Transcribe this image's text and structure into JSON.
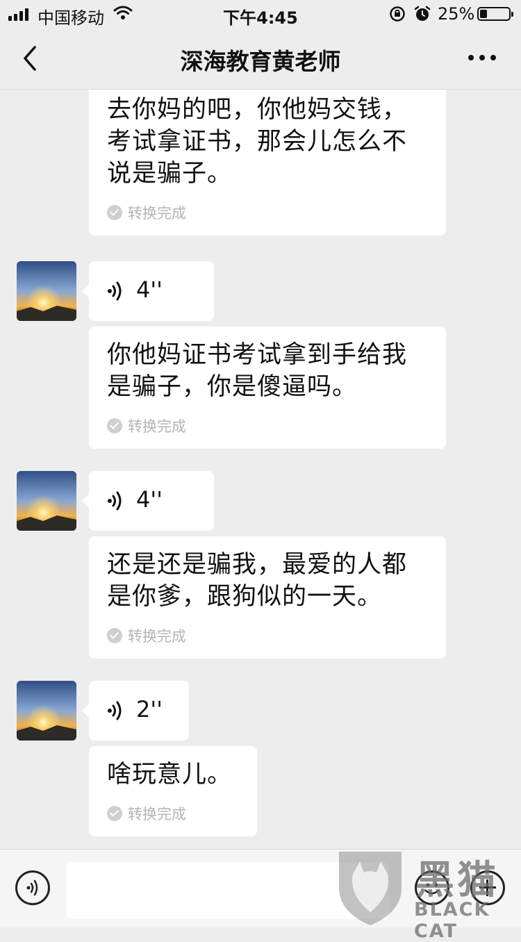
{
  "status_bar": {
    "carrier": "中国移动",
    "time": "下午4:45",
    "battery_percent": "25%",
    "battery_level": 0.25
  },
  "nav": {
    "title": "深海教育黄老师"
  },
  "messages": [
    {
      "type": "transcription",
      "text": "去你妈的吧，你他妈交钱，考试拿证书，那会儿怎么不说是骗子。",
      "status": "转换完成"
    },
    {
      "type": "voice",
      "duration": "4''"
    },
    {
      "type": "transcription",
      "text": "你他妈证书考试拿到手给我是骗子，你是傻逼吗。",
      "status": "转换完成"
    },
    {
      "type": "voice",
      "duration": "4''"
    },
    {
      "type": "transcription",
      "text": "还是还是骗我，最爱的人都是你爹，跟狗似的一天。",
      "status": "转换完成"
    },
    {
      "type": "voice",
      "duration": "2''"
    },
    {
      "type": "transcription",
      "text": "啥玩意儿。",
      "status": "转换完成"
    }
  ],
  "watermark": {
    "cn": "黑猫",
    "en": "BLACK CAT"
  },
  "icons": {
    "back": "chevron-left-icon",
    "more": "more-dots-icon",
    "voice_input": "voice-input-icon",
    "emoji": "emoji-icon",
    "plus": "plus-icon"
  }
}
